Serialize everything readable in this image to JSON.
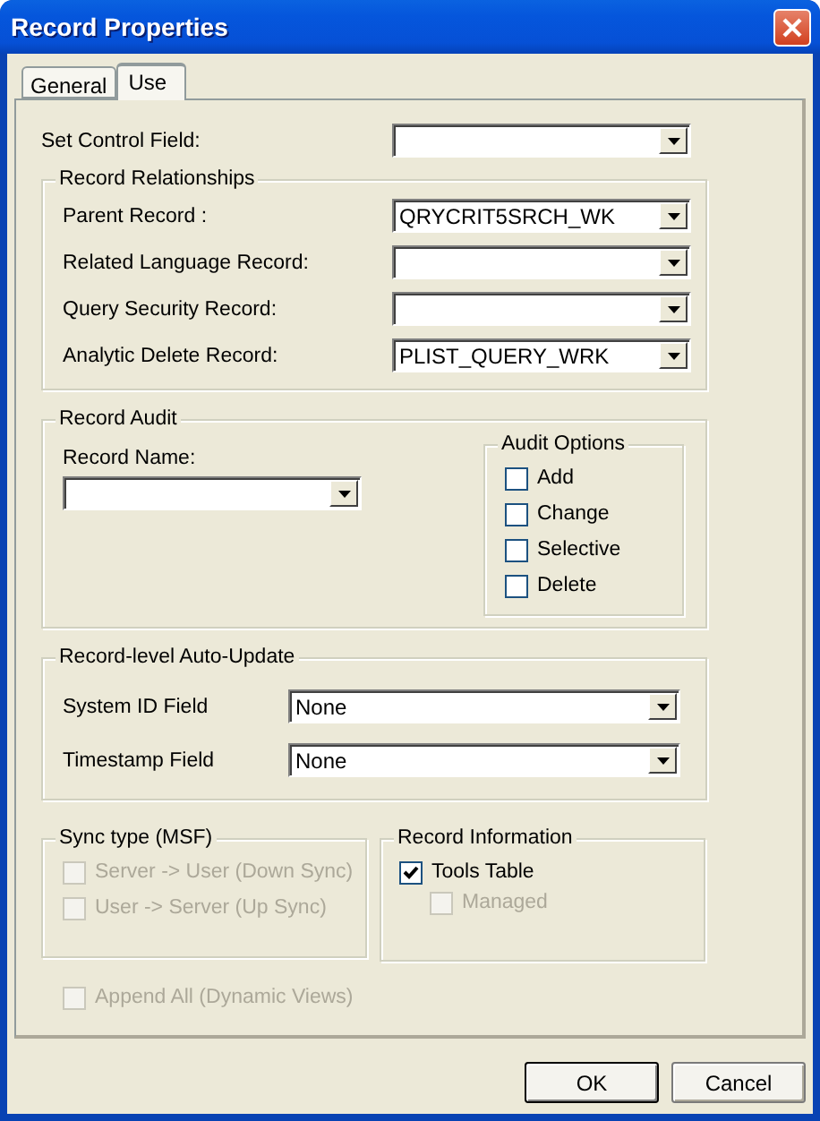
{
  "window": {
    "title": "Record Properties"
  },
  "tabs": [
    {
      "label": "General",
      "selected": false
    },
    {
      "label": "Use",
      "selected": true
    }
  ],
  "set_control_field": {
    "label": "Set Control Field:"
  },
  "record_relationships": {
    "title": "Record Relationships",
    "fields": [
      {
        "label": "Parent Record :",
        "value": "QRYCRIT5SRCH_WK"
      },
      {
        "label": "Related Language Record:"
      },
      {
        "label": "Query Security Record:"
      },
      {
        "label": "Analytic Delete Record:",
        "value": "PLIST_QUERY_WRK"
      }
    ]
  },
  "record_audit": {
    "title": "Record Audit",
    "record_name": {
      "label": "Record Name:"
    },
    "audit_options": {
      "title": "Audit Options",
      "options": [
        {
          "label": "Add",
          "checked": false
        },
        {
          "label": "Change",
          "checked": false
        },
        {
          "label": "Selective",
          "checked": false
        },
        {
          "label": "Delete",
          "checked": false
        }
      ]
    }
  },
  "auto_update": {
    "title": "Record-level Auto-Update",
    "fields": [
      {
        "label": "System ID Field",
        "value": "None"
      },
      {
        "label": "Timestamp Field",
        "value": "None"
      }
    ]
  },
  "sync_type": {
    "title": "Sync type (MSF)",
    "options": [
      {
        "label": "Server -> User (Down Sync)",
        "checked": false,
        "disabled": true
      },
      {
        "label": "User -> Server (Up Sync)",
        "checked": false,
        "disabled": true
      }
    ]
  },
  "record_information": {
    "title": "Record Information",
    "options": [
      {
        "label": "Tools Table",
        "checked": true,
        "disabled": false,
        "children": [
          {
            "label": "Managed",
            "checked": false,
            "disabled": true
          }
        ]
      }
    ]
  },
  "append_all": {
    "label": "Append All (Dynamic Views)",
    "checked": false,
    "disabled": true
  },
  "buttons": [
    {
      "label": "OK",
      "default": true
    },
    {
      "label": "Cancel",
      "default": false
    }
  ]
}
